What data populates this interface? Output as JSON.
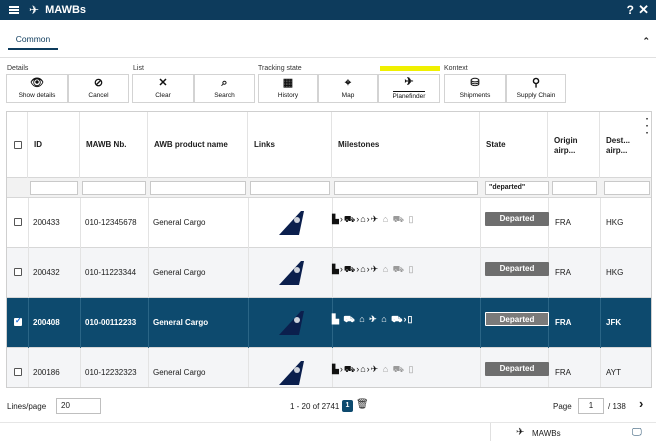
{
  "titlebar": {
    "title": "MAWBs",
    "help": "?",
    "close": "✕"
  },
  "tabs": [
    {
      "label": "Common"
    }
  ],
  "ribbon": {
    "groups": [
      "Details",
      "List",
      "Tracking state",
      "Kontext"
    ],
    "buttons": [
      {
        "label": "Show details",
        "icon": "👁"
      },
      {
        "label": "Cancel",
        "icon": "⊘"
      },
      {
        "label": "Clear",
        "icon": "✕"
      },
      {
        "label": "Search",
        "icon": "⌕"
      },
      {
        "label": "History",
        "icon": "▦"
      },
      {
        "label": "Map",
        "icon": "⌖"
      },
      {
        "label": "Planefinder",
        "icon": "✈"
      },
      {
        "label": "Shipments",
        "icon": "⛁"
      },
      {
        "label": "Supply Chain",
        "icon": "⚲"
      }
    ]
  },
  "table": {
    "columns": [
      "ID",
      "MAWB Nb.",
      "AWB product name",
      "Links",
      "Milestones",
      "State",
      "Origin airp...",
      "Dest... airp..."
    ],
    "filters": {
      "state": "\"departed\""
    },
    "rows": [
      {
        "id": "200433",
        "mawb": "010-12345678",
        "product": "General Cargo",
        "state": "Departed",
        "origin": "FRA",
        "dest": "HKG",
        "selected": false
      },
      {
        "id": "200432",
        "mawb": "010-11223344",
        "product": "General Cargo",
        "state": "Departed",
        "origin": "FRA",
        "dest": "HKG",
        "selected": false
      },
      {
        "id": "200408",
        "mawb": "010-00112233",
        "product": "General Cargo",
        "state": "Departed",
        "origin": "FRA",
        "dest": "JFK",
        "selected": true
      },
      {
        "id": "200186",
        "mawb": "010-12232323",
        "product": "General Cargo",
        "state": "Departed",
        "origin": "FRA",
        "dest": "AYT",
        "selected": false
      }
    ]
  },
  "footer": {
    "lines_label": "Lines/page",
    "lines_value": "20",
    "range": "1 - 20 of 2741",
    "badge": "1",
    "page_label": "Page",
    "page_value": "1",
    "page_of": "/ 138"
  },
  "taskbar": {
    "label": "MAWBs"
  },
  "colors": {
    "brand": "#0d3b5c",
    "selected_row": "#0d4a6e",
    "badge": "#6e6e6e",
    "highlight": "#f0f000"
  }
}
